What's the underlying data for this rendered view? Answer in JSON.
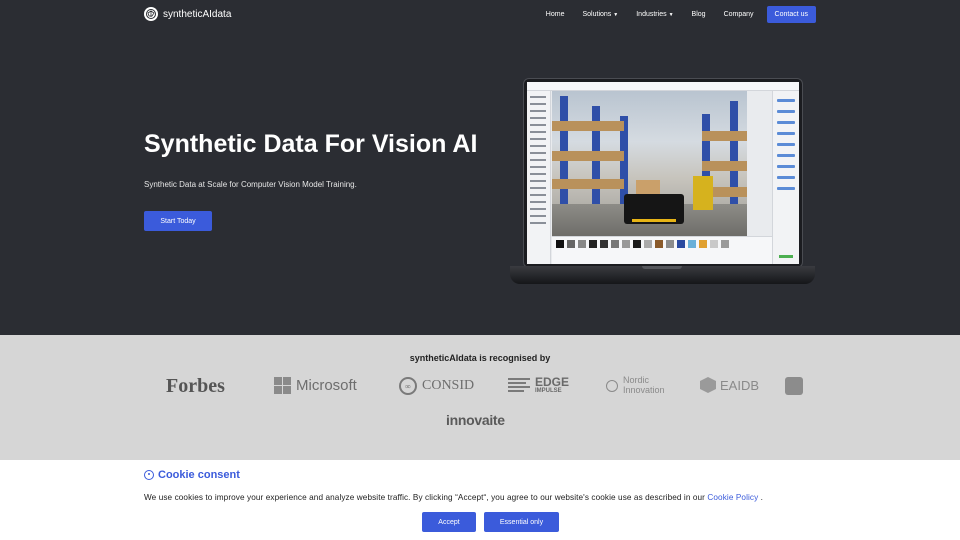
{
  "nav": {
    "brand": "syntheticAIdata",
    "items": [
      {
        "label": "Home",
        "dropdown": false
      },
      {
        "label": "Solutions",
        "dropdown": true
      },
      {
        "label": "Industries",
        "dropdown": true
      },
      {
        "label": "Blog",
        "dropdown": false
      },
      {
        "label": "Company",
        "dropdown": false
      }
    ],
    "contact_label": "Contact us"
  },
  "hero": {
    "title": "Synthetic Data For Vision AI",
    "subtitle": "Synthetic Data at Scale for Computer Vision Model Training.",
    "cta_label": "Start Today"
  },
  "recognised": {
    "title": "syntheticAIdata is recognised by",
    "logos": {
      "forbes": "Forbes",
      "microsoft": "Microsoft",
      "consid": "CONSID",
      "edge_main": "EDGE",
      "edge_sub": "IMPULSE",
      "nordic_line1": "Nordic",
      "nordic_line2": "Innovation",
      "eaidb": "EAIDB",
      "innovaite": "innovaite"
    }
  },
  "cookie": {
    "title": "Cookie consent",
    "text": "We use cookies to improve your experience and analyze website traffic. By clicking “Accept“, you agree to our website's cookie use as described in our ",
    "link_label": "Cookie Policy",
    "text_end": " .",
    "accept_label": "Accept",
    "essential_label": "Essential only"
  },
  "colors": {
    "accent": "#3b5bdb",
    "hero_bg": "#2b2d33",
    "recognised_bg": "#d6d6d6"
  },
  "icons": {
    "brand": "brain-network-icon",
    "dropdown": "caret-down-icon",
    "cookie": "cookie-icon"
  }
}
